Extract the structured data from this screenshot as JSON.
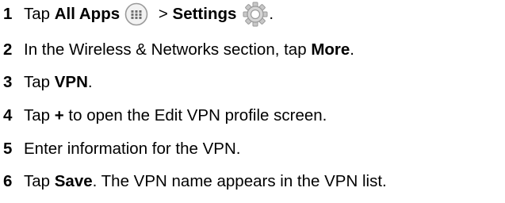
{
  "steps": [
    {
      "number": "1",
      "parts": {
        "a": "Tap ",
        "b_all_apps": "All Apps",
        "sep": " > ",
        "b_settings": "Settings",
        "end": "."
      },
      "icons": [
        "all-apps-icon",
        "settings-gear-icon"
      ]
    },
    {
      "number": "2",
      "parts": {
        "a": "In the Wireless & Networks section, tap ",
        "b": "More",
        "end": "."
      }
    },
    {
      "number": "3",
      "parts": {
        "a": "Tap ",
        "b": "VPN",
        "end": "."
      }
    },
    {
      "number": "4",
      "parts": {
        "a": "Tap ",
        "b": "+",
        "end": " to open the Edit VPN profile screen."
      }
    },
    {
      "number": "5",
      "parts": {
        "a": "Enter information for the VPN."
      }
    },
    {
      "number": "6",
      "parts": {
        "a": "Tap ",
        "b": "Save",
        "end": ". The VPN name appears in the VPN list."
      }
    }
  ],
  "colors": {
    "text": "#000000",
    "icon_gray": "#9a9a9a",
    "icon_fill": "#f2f2f2"
  }
}
